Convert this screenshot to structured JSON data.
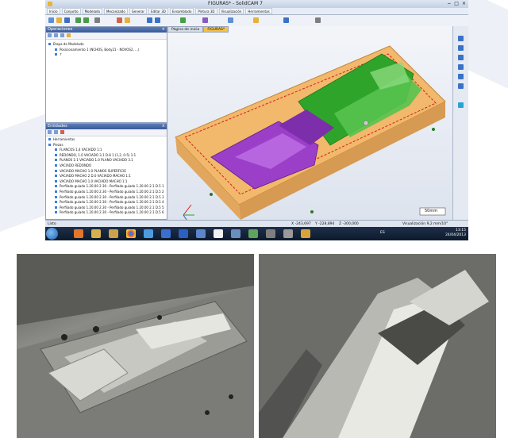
{
  "window": {
    "title": "FIGURAS* - SolidCAM 7",
    "controls": [
      "−",
      "□",
      "×"
    ]
  },
  "menu": {
    "items": [
      "Inicio",
      "Conjunto",
      "Modelado",
      "Mecanizado",
      "Generar",
      "Editar 3D",
      "Ensamblado",
      "Pintura 3D",
      "Visualización",
      "Herramientas"
    ]
  },
  "operations_panel": {
    "title": "Operaciones",
    "close": "×",
    "tree": [
      {
        "label": "Etapa de Modelado",
        "indent": 0
      },
      {
        "label": "Posicionamiento 1 (NCHOS, Body21 - NOVOS2, ...)",
        "indent": 1
      },
      {
        "label": "↑",
        "indent": 1
      }
    ]
  },
  "entities_panel": {
    "title": "Entidades",
    "close": "×",
    "tree": [
      {
        "label": "Herramientas",
        "indent": 0
      },
      {
        "label": "Piezas",
        "indent": 0
      },
      {
        "label": "FLANCOS 1,4 VACIADO 1:1",
        "indent": 1
      },
      {
        "label": "REDONDO, 1.0 VACIADO 3.1 D.8 1 (1,2, 0-5) 1:1",
        "indent": 1
      },
      {
        "label": "PLANOS 1:1 VACIADO 1.0 PLANO VACIADO 3.1",
        "indent": 1
      },
      {
        "label": "VACIADO REDONDO",
        "indent": 1
      },
      {
        "label": "VACIADO MACHO 1.0 PLANOS SUPERFICIE",
        "indent": 1
      },
      {
        "label": "VACIADO MACHO 2 D.0 VACIADO MACHO 1:1",
        "indent": 1
      },
      {
        "label": "VACIADO MACHO 1.0 VACIADO MACHO 1:1",
        "indent": 1
      },
      {
        "label": "Perfilado guiado 1.20.00 2.30 - Perfilado guiado 1.20.00 2.1 D.5 1",
        "indent": 1
      },
      {
        "label": "Perfilado guiado 1.20.00 2.30 - Perfilado guiado 1.20.00 2.1 D.5 2",
        "indent": 1
      },
      {
        "label": "Perfilado guiado 1.20.00 2.30 - Perfilado guiado 1.20.00 2.1 D.5 3",
        "indent": 1
      },
      {
        "label": "Perfilado guiado 1.20.00 2.30 - Perfilado guiado 1.20.00 2.1 D.5 4",
        "indent": 1
      },
      {
        "label": "Perfilado guiado 1.20.00 2.30 - Perfilado guiado 1.20.00 2.1 D.5 5",
        "indent": 1
      },
      {
        "label": "Perfilado guiado 1.20.00 2.30 - Perfilado guiado 1.20.00 2.1 D.5 6",
        "indent": 1
      }
    ]
  },
  "viewport": {
    "tabs": [
      "Página de inicio",
      "FIGURAS*"
    ],
    "active_tab": 1,
    "scale_label": "50mm"
  },
  "status_bar": {
    "left": "Listo",
    "x": "X  -243,697",
    "y": "Y  -228,894",
    "z": "Z  -300,000",
    "visualization": "Visualización  9,2 mm/10°"
  },
  "taskbar": {
    "language": "ES",
    "time": "13:15",
    "date": "24/04/2013"
  },
  "colors": {
    "block": "#f2b86b",
    "green_surface": "#2ea52a",
    "purple_surface": "#9b3fc9",
    "accent_tab": "#f3c14a"
  }
}
